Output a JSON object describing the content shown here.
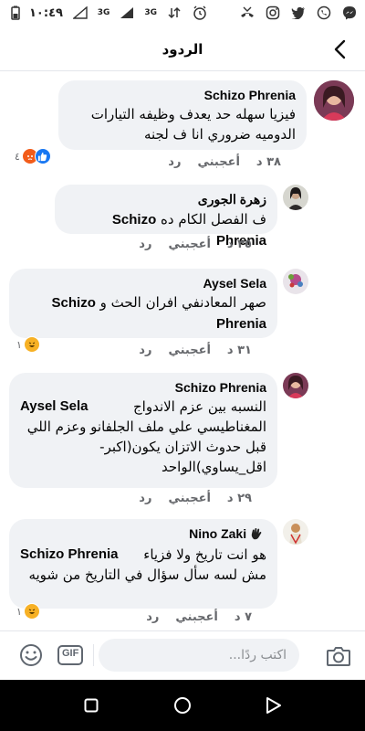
{
  "status_bar": {
    "time": "١٠:٤٩",
    "network_1": "3G",
    "network_2": "3G"
  },
  "header": {
    "title": "الردود"
  },
  "comments": [
    {
      "author": "Schizo Phrenia",
      "text": "فيزيا سهله حد يعدف وظيفه التيارات الدوميه ضروري انا ف لجنه",
      "time": "٣٨ د",
      "like": "أعجبني",
      "reply": "رد",
      "reaction_count": "٤"
    },
    {
      "author": "زهرة الجورى",
      "mention": "Schizo Phrenia",
      "text": "ف الفصل الكام ده",
      "time": "٣٥ د",
      "like": "أعجبني",
      "reply": "رد"
    },
    {
      "author": "Aysel Sela",
      "mention": "Schizo Phrenia",
      "text": "صهر المعادنفي افران الحث و",
      "time": "٣١ د",
      "like": "أعجبني",
      "reply": "رد",
      "reaction_count": "١"
    },
    {
      "author": "Schizo Phrenia",
      "mention": "Aysel Sela",
      "text": "النسبه بين عزم الاندواج المغناطيسي علي ملف الجلفانو وعزم اللي قبل حدوث الاتزان يكون(اكبر-اقل_يساوي)الواحد",
      "time": "٢٩ د",
      "like": "أعجبني",
      "reply": "رد"
    },
    {
      "author": "Nino Zaki",
      "mention": "Schizo Phrenia",
      "text": "هو انت تاريخ ولا فزياء مش لسه سأل سؤال في التاريخ من شويه",
      "time": "٧ د",
      "like": "أعجبني",
      "reply": "رد",
      "reaction_count": "١"
    }
  ],
  "composer": {
    "placeholder": "اكتب ردًا...",
    "gif_label": "GIF"
  },
  "colors": {
    "bubble": "#f0f2f5",
    "meta_text": "#65676b",
    "like_blue": "#1877f2",
    "angry_orange": "#f25c1a",
    "haha_yellow": "#f7b125"
  }
}
